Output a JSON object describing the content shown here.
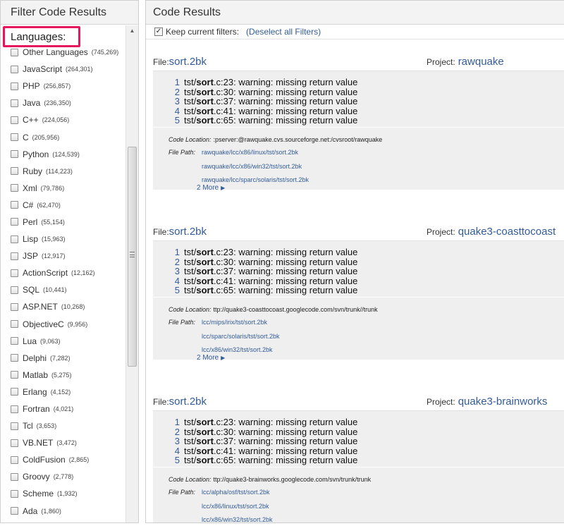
{
  "filter_panel": {
    "title": "Filter Code Results",
    "languages_heading": "Languages:",
    "scroll_up_glyph": "▲",
    "scroll_down_glyph": "▼",
    "items": [
      {
        "label": "Other Languages",
        "count": "(745,269)"
      },
      {
        "label": "JavaScript",
        "count": "(264,301)"
      },
      {
        "label": "PHP",
        "count": "(256,857)"
      },
      {
        "label": "Java",
        "count": "(236,350)"
      },
      {
        "label": "C++",
        "count": "(224,056)"
      },
      {
        "label": "C",
        "count": "(205,956)"
      },
      {
        "label": "Python",
        "count": "(124,539)"
      },
      {
        "label": "Ruby",
        "count": "(114,223)"
      },
      {
        "label": "Xml",
        "count": "(79,786)"
      },
      {
        "label": "C#",
        "count": "(62,470)"
      },
      {
        "label": "Perl",
        "count": "(55,154)"
      },
      {
        "label": "Lisp",
        "count": "(15,963)"
      },
      {
        "label": "JSP",
        "count": "(12,917)"
      },
      {
        "label": "ActionScript",
        "count": "(12,162)"
      },
      {
        "label": "SQL",
        "count": "(10,441)"
      },
      {
        "label": "ASP.NET",
        "count": "(10,268)"
      },
      {
        "label": "ObjectiveC",
        "count": "(9,956)"
      },
      {
        "label": "Lua",
        "count": "(9,063)"
      },
      {
        "label": "Delphi",
        "count": "(7,282)"
      },
      {
        "label": "Matlab",
        "count": "(5,275)"
      },
      {
        "label": "Erlang",
        "count": "(4,152)"
      },
      {
        "label": "Fortran",
        "count": "(4,021)"
      },
      {
        "label": "Tcl",
        "count": "(3,653)"
      },
      {
        "label": "VB.NET",
        "count": "(3,472)"
      },
      {
        "label": "ColdFusion",
        "count": "(2,865)"
      },
      {
        "label": "Groovy",
        "count": "(2,778)"
      },
      {
        "label": "Scheme",
        "count": "(1,932)"
      },
      {
        "label": "Ada",
        "count": "(1,860)"
      }
    ]
  },
  "results_panel": {
    "title": "Code Results",
    "keep_filters_check": "✓",
    "keep_filters_label": "Keep current filters:",
    "deselect_label": "(Deselect all Filters)",
    "file_label": "File:",
    "project_label": "Project:",
    "code_location_label": "Code Location:",
    "file_path_label": "File Path:",
    "more_arrow": "▶",
    "results": [
      {
        "file": "sort.2bk",
        "project": "rawquake",
        "lines": [
          {
            "num": "1",
            "pre": "tst/",
            "bold": "sort",
            "post": ".c:23: warning: missing return value"
          },
          {
            "num": "2",
            "pre": "tst/",
            "bold": "sort",
            "post": ".c:30: warning: missing return value"
          },
          {
            "num": "3",
            "pre": "tst/",
            "bold": "sort",
            "post": ".c:37: warning: missing return value"
          },
          {
            "num": "4",
            "pre": "tst/",
            "bold": "sort",
            "post": ".c:41: warning: missing return value"
          },
          {
            "num": "5",
            "pre": "tst/",
            "bold": "sort",
            "post": ".c:65: warning: missing return value"
          }
        ],
        "code_location": ":pserver:@rawquake.cvs.sourceforge.net:/cvsroot/rawquake",
        "paths": [
          "rawquake/lcc/x86/linux/tst/sort.2bk",
          "rawquake/lcc/x86/win32/tst/sort.2bk",
          "rawquake/lcc/sparc/solaris/tst/sort.2bk"
        ],
        "more": "2 More"
      },
      {
        "file": "sort.2bk",
        "project": "quake3-coasttocoast",
        "lines": [
          {
            "num": "1",
            "pre": "tst/",
            "bold": "sort",
            "post": ".c:23: warning: missing return value"
          },
          {
            "num": "2",
            "pre": "tst/",
            "bold": "sort",
            "post": ".c:30: warning: missing return value"
          },
          {
            "num": "3",
            "pre": "tst/",
            "bold": "sort",
            "post": ".c:37: warning: missing return value"
          },
          {
            "num": "4",
            "pre": "tst/",
            "bold": "sort",
            "post": ".c:41: warning: missing return value"
          },
          {
            "num": "5",
            "pre": "tst/",
            "bold": "sort",
            "post": ".c:65: warning: missing return value"
          }
        ],
        "code_location": "ttp://quake3-coasttocoast.googlecode.com/svn/trunk//trunk",
        "paths": [
          "lcc/mips/irix/tst/sort.2bk",
          "lcc/sparc/solaris/tst/sort.2bk",
          "lcc/x86/win32/tst/sort.2bk"
        ],
        "more": "2 More"
      },
      {
        "file": "sort.2bk",
        "project": "quake3-brainworks",
        "lines": [
          {
            "num": "1",
            "pre": "tst/",
            "bold": "sort",
            "post": ".c:23: warning: missing return value"
          },
          {
            "num": "2",
            "pre": "tst/",
            "bold": "sort",
            "post": ".c:30: warning: missing return value"
          },
          {
            "num": "3",
            "pre": "tst/",
            "bold": "sort",
            "post": ".c:37: warning: missing return value"
          },
          {
            "num": "4",
            "pre": "tst/",
            "bold": "sort",
            "post": ".c:41: warning: missing return value"
          },
          {
            "num": "5",
            "pre": "tst/",
            "bold": "sort",
            "post": ".c:65: warning: missing return value"
          }
        ],
        "code_location": "ttp://quake3-brainworks.googlecode.com/svn/trunk/trunk",
        "paths": [
          "lcc/alpha/osf/tst/sort.2bk",
          "lcc/x86/linux/tst/sort.2bk",
          "lcc/x86/win32/tst/sort.2bk"
        ],
        "more": ""
      }
    ]
  }
}
